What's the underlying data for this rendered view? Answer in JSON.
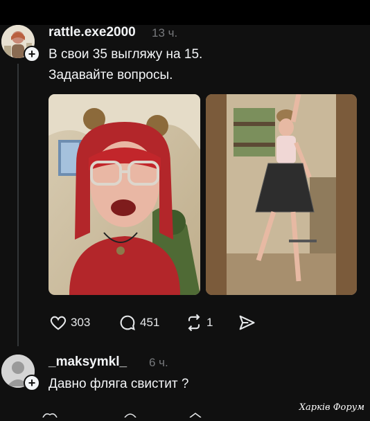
{
  "post": {
    "username": "rattle.exe2000",
    "time": "13 ч.",
    "text_line1": "В свои 35 выгляжу на 15.",
    "text_line2": "Задавайте вопросы.",
    "actions": {
      "likes": "303",
      "comments": "451",
      "reposts": "1"
    }
  },
  "reply": {
    "username": "_maksymkl_",
    "time": "6 ч.",
    "text": "Давно фляга свистит ?"
  },
  "watermark": "Харків Форум",
  "colors": {
    "background": "#101010",
    "text": "#f3f5f7",
    "muted": "#77797c",
    "thread_line": "#333638"
  },
  "icons": [
    "heart-icon",
    "comment-icon",
    "repost-icon",
    "share-icon",
    "plus-icon"
  ]
}
